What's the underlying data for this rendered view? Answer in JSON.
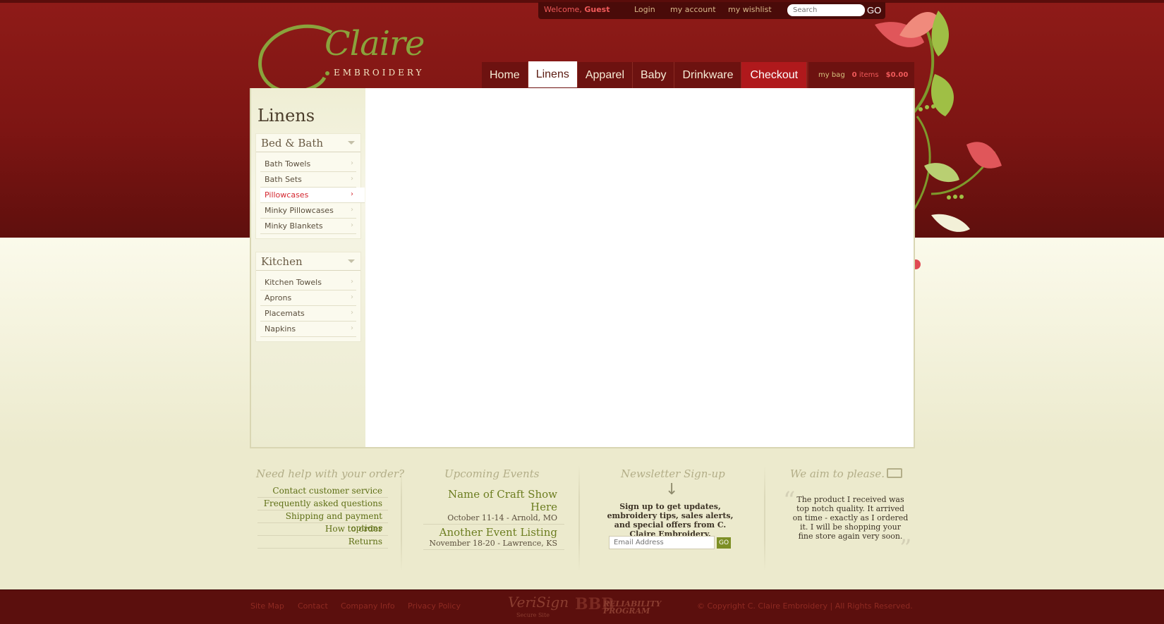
{
  "colors": {
    "header_red": "#7d1513",
    "footer_red": "#5b0f0d",
    "accent_green": "#6c7d20",
    "active_red": "#d4272f",
    "cream": "#eceacd"
  },
  "utility": {
    "welcome_label": "Welcome,",
    "user": "Guest",
    "login": "Login",
    "my_account": "my account",
    "my_wishlist": "my wishlist",
    "search_placeholder": "Search",
    "search_go": "GO"
  },
  "logo": {
    "script": "Claire",
    "sub": "EMBROIDERY"
  },
  "nav": {
    "items": [
      {
        "label": "Home"
      },
      {
        "label": "Linens"
      },
      {
        "label": "Apparel"
      },
      {
        "label": "Baby"
      },
      {
        "label": "Drinkware"
      },
      {
        "label": "Checkout"
      }
    ],
    "active": "Linens"
  },
  "bag": {
    "label": "my bag",
    "items_count": "0",
    "items_label": "items",
    "total": "$0.00"
  },
  "sidebar": {
    "title": "Linens",
    "categories": [
      {
        "name": "Bed & Bath",
        "items": [
          "Bath Towels",
          "Bath Sets",
          "Pillowcases",
          "Minky Pillowcases",
          "Minky Blankets"
        ],
        "active": "Pillowcases"
      },
      {
        "name": "Kitchen",
        "items": [
          "Kitchen Towels",
          "Aprons",
          "Placemats",
          "Napkins"
        ]
      }
    ]
  },
  "footer": {
    "help": {
      "title": "Need help with your order?",
      "links": [
        "Contact customer service",
        "Frequently asked questions",
        "Shipping and payment options",
        "How to order",
        "Returns"
      ]
    },
    "events": {
      "title": "Upcoming Events",
      "items": [
        {
          "name": "Name of Craft Show Here",
          "date": "October 11-14 - Arnold, MO"
        },
        {
          "name": "Another Event Listing",
          "date": "November 18-20 - Lawrence, KS"
        }
      ]
    },
    "newsletter": {
      "title": "Newsletter Sign-up",
      "text": "Sign up to get updates, embroidery tips, sales alerts, and special offers from  C. Claire Embroidery.",
      "email_placeholder": "Email Address",
      "go": "GO"
    },
    "testimonial": {
      "title": "We aim to please.",
      "quote": "The product I received was top notch quality. It arrived on time - exactly as I ordered it. I will be shopping your fine store again very soon."
    }
  },
  "bottom": {
    "links": [
      "Site Map",
      "Contact",
      "Company Info",
      "Privacy Policy"
    ],
    "verisign": "VeriSign",
    "verisign_sub": "Secure Site",
    "bbb": "BBB",
    "bbb_program": "RELIABILITY PROGRAM",
    "copyright": "© Copyright C. Claire Embroidery | All Rights Reserved."
  }
}
